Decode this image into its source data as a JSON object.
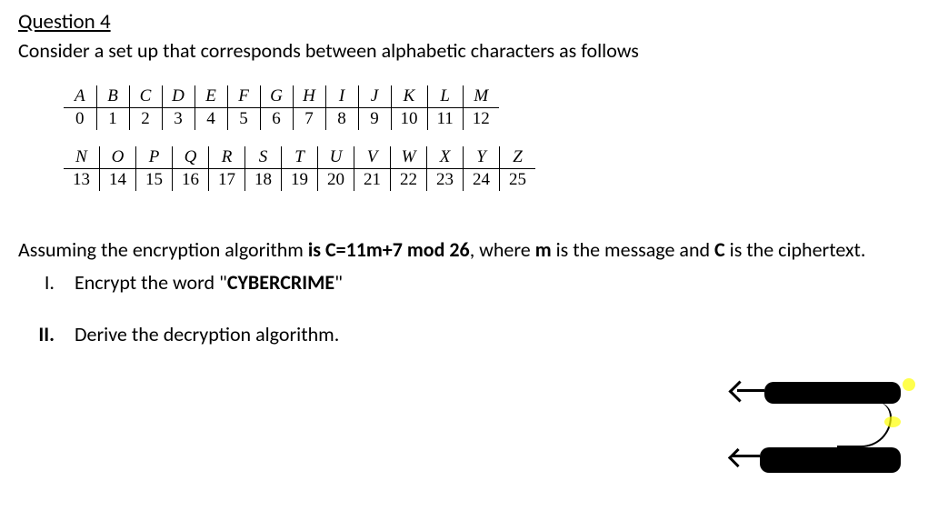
{
  "title": "Question 4",
  "intro": "Consider a set up that corresponds between alphabetic characters as follows",
  "table1": {
    "letters": [
      "A",
      "B",
      "C",
      "D",
      "E",
      "F",
      "G",
      "H",
      "I",
      "J",
      "K",
      "L",
      "M"
    ],
    "numbers": [
      "0",
      "1",
      "2",
      "3",
      "4",
      "5",
      "6",
      "7",
      "8",
      "9",
      "10",
      "11",
      "12"
    ]
  },
  "table2": {
    "letters": [
      "N",
      "O",
      "P",
      "Q",
      "R",
      "S",
      "T",
      "U",
      "V",
      "W",
      "X",
      "Y",
      "Z"
    ],
    "numbers": [
      "13",
      "14",
      "15",
      "16",
      "17",
      "18",
      "19",
      "20",
      "21",
      "22",
      "23",
      "24",
      "25"
    ]
  },
  "assumption": {
    "pre": "Assuming the encryption algorithm ",
    "formula": "is C=11m+7 mod 26",
    "mid": ", where ",
    "mvar": "m",
    "post1": " is the message and ",
    "cvar": "C",
    "post2": " is the ciphertext."
  },
  "parts": {
    "p1": {
      "numeral": "I.",
      "pre": "Encrypt the word \"",
      "word": "CYBERCRIME",
      "post": "\""
    },
    "p2": {
      "numeral": "II.",
      "text": "Derive the decryption algorithm."
    }
  }
}
